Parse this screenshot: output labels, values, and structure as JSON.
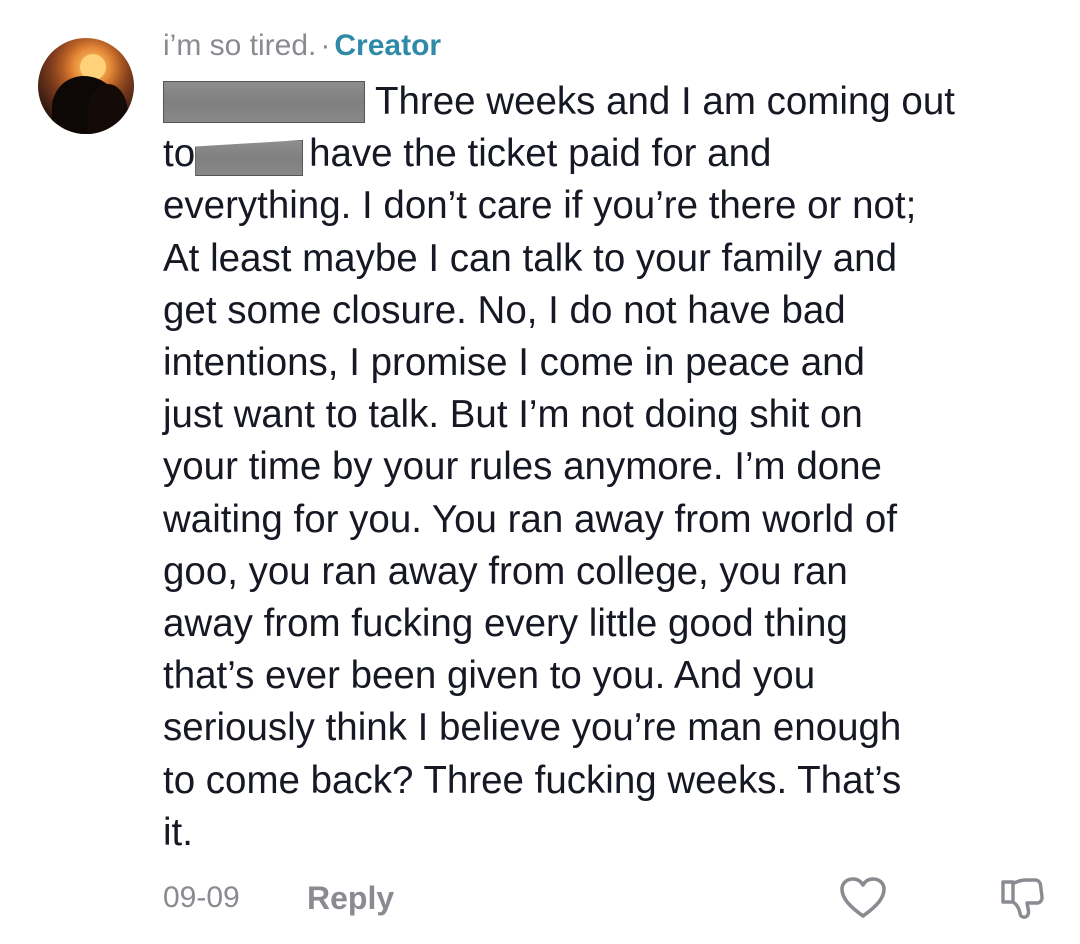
{
  "comment": {
    "username": "i’m so tired.",
    "separator": "·",
    "creator_badge": "Creator",
    "text_lines": [
      "Three weeks and I am coming out",
      "to",
      "have the ticket paid for and",
      "everything. I don’t care if you’re there or not;",
      "At least maybe I can talk to your family and",
      "get some closure. No, I do not have bad",
      "intentions, I promise I come in peace and",
      "just want to talk. But I’m not doing shit on",
      "your time by your rules anymore. I’m done",
      "waiting for you. You ran away from world of",
      "goo, you ran away from college, you ran",
      "away from fucking every little good thing",
      "that’s ever been given to you. And you",
      "seriously think I believe you’re man enough",
      "to come back? Three fucking weeks. That’s",
      "it."
    ],
    "timestamp": "09-09",
    "reply_label": "Reply",
    "like_icon": "heart-outline-icon",
    "dislike_icon": "thumbs-down-outline-icon"
  },
  "colors": {
    "text": "#161823",
    "muted": "#8a8b91",
    "creator": "#2f8aa8",
    "redaction": "#878787"
  }
}
